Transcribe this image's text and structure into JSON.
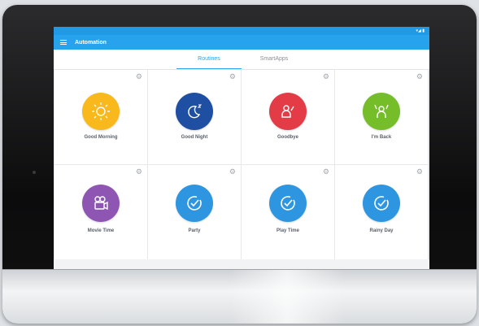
{
  "header": {
    "title": "Automation"
  },
  "tabs": [
    {
      "label": "Routines",
      "active": true
    },
    {
      "label": "SmartApps",
      "active": false
    }
  ],
  "colors": {
    "accent": "#26a3ec",
    "good_morning": "#f9b81c",
    "good_night": "#1f4fa3",
    "goodbye": "#e43c47",
    "im_back": "#76bd2a",
    "movie_time": "#8e55b3",
    "routine_default": "#2e96e0"
  },
  "tiles": [
    {
      "label": "Good Morning",
      "icon": "sun-icon"
    },
    {
      "label": "Good Night",
      "icon": "moon-sleep-icon"
    },
    {
      "label": "Goodbye",
      "icon": "waving-person-icon"
    },
    {
      "label": "I'm Back",
      "icon": "person-arms-up-icon"
    },
    {
      "label": "Movie Time",
      "icon": "movie-camera-icon"
    },
    {
      "label": "Party",
      "icon": "check-circle-icon"
    },
    {
      "label": "Play Time",
      "icon": "check-circle-icon"
    },
    {
      "label": "Rainy Day",
      "icon": "check-circle-icon"
    }
  ]
}
